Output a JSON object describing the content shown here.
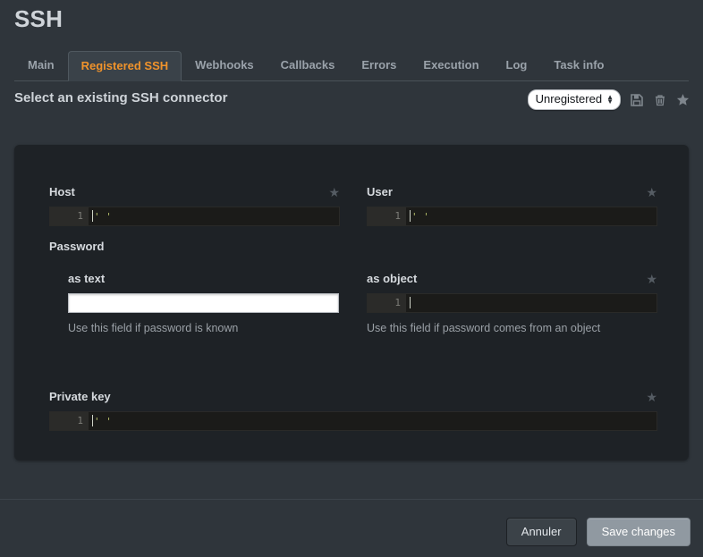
{
  "page": {
    "title": "SSH"
  },
  "tabs": [
    {
      "label": "Main",
      "active": false
    },
    {
      "label": "Registered SSH",
      "active": true
    },
    {
      "label": "Webhooks",
      "active": false
    },
    {
      "label": "Callbacks",
      "active": false
    },
    {
      "label": "Errors",
      "active": false
    },
    {
      "label": "Execution",
      "active": false
    },
    {
      "label": "Log",
      "active": false
    },
    {
      "label": "Task info",
      "active": false
    }
  ],
  "header": {
    "subtitle": "Select an existing SSH connector",
    "connector_select": {
      "selected": "Unregistered",
      "options": [
        "Unregistered"
      ]
    },
    "icons": {
      "save": "save-icon",
      "delete": "trash-icon",
      "favorite": "star-icon"
    }
  },
  "form": {
    "host": {
      "label": "Host",
      "star": "★",
      "editor": {
        "line_number": "1",
        "value": "' '"
      }
    },
    "user": {
      "label": "User",
      "star": "★",
      "editor": {
        "line_number": "1",
        "value": "' '"
      }
    },
    "password": {
      "label": "Password",
      "as_text": {
        "label": "as text",
        "value": "",
        "placeholder": "",
        "help": "Use this field if password is known"
      },
      "as_object": {
        "label": "as object",
        "star": "★",
        "editor": {
          "line_number": "1",
          "value": ""
        },
        "help": "Use this field if password comes from an object"
      }
    },
    "private_key": {
      "label": "Private key",
      "star": "★",
      "editor": {
        "line_number": "1",
        "value": "' '"
      }
    }
  },
  "footer": {
    "cancel_label": "Annuler",
    "save_label": "Save changes"
  },
  "colors": {
    "accent": "#f0932b",
    "background": "#2f353b",
    "panel": "#1e2226",
    "editor_bg": "#1b1b19",
    "text": "#d6dade",
    "muted": "#9aa0a6"
  }
}
